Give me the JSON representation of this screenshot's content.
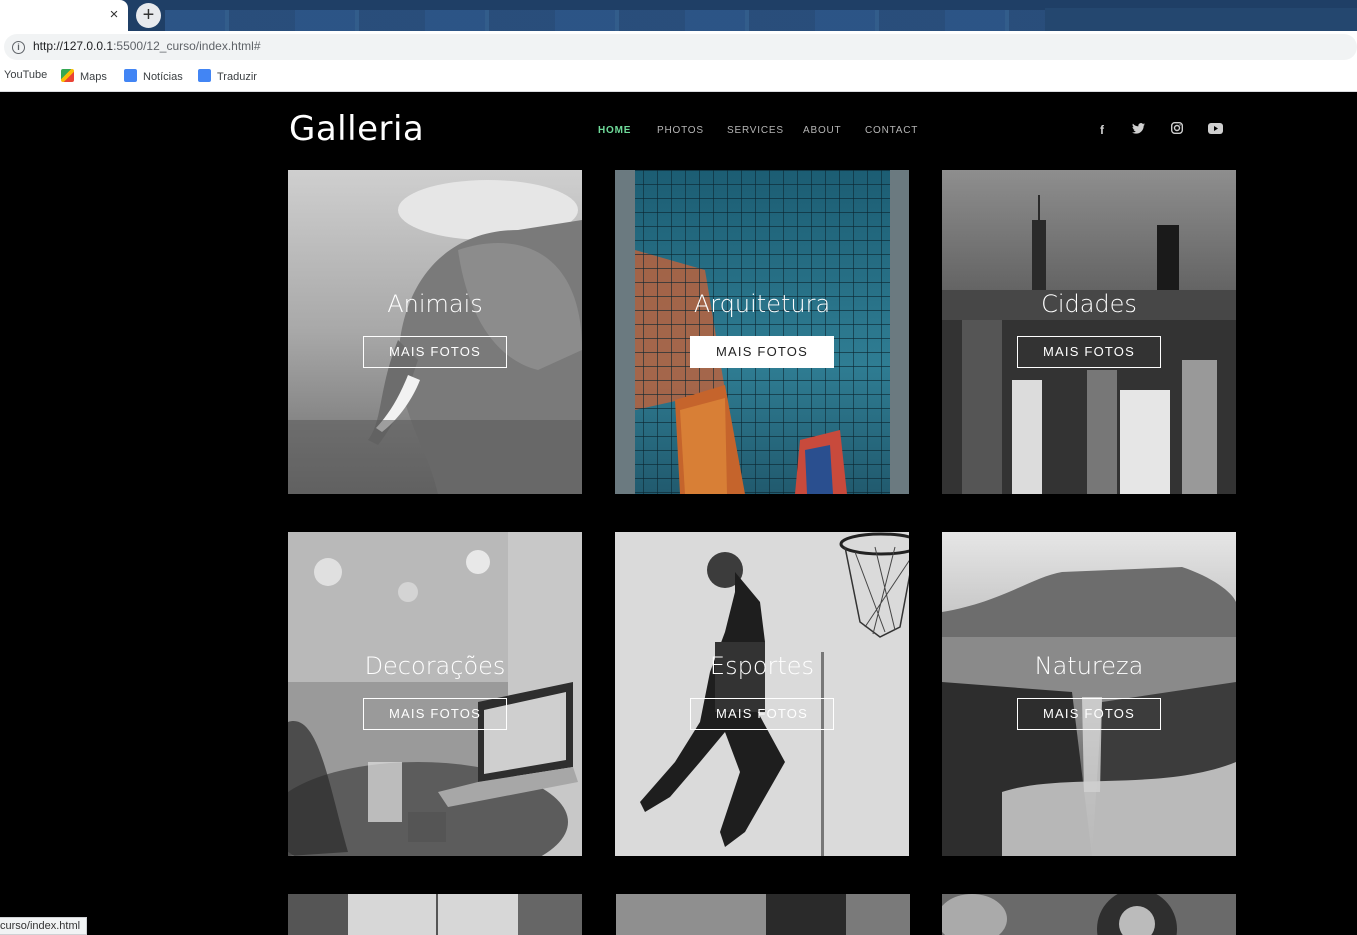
{
  "browser": {
    "tab_close": "×",
    "new_tab": "+",
    "url_host": "http://127.0.0.1",
    "url_rest": ":5500/12_curso/index.html#",
    "bookmarks": [
      {
        "label": "YouTube",
        "icon": "youtube-icon",
        "color": ""
      },
      {
        "label": "Maps",
        "icon": "maps-icon",
        "color": "#34a853"
      },
      {
        "label": "Notícias",
        "icon": "news-icon",
        "color": "#4285f4"
      },
      {
        "label": "Traduzir",
        "icon": "translate-icon",
        "color": "#4285f4"
      }
    ],
    "status_url": "curso/index.html"
  },
  "site": {
    "logo": "Galleria",
    "nav": [
      {
        "label": "HOME",
        "active": true
      },
      {
        "label": "PHOTOS",
        "active": false
      },
      {
        "label": "SERVICES",
        "active": false
      },
      {
        "label": "ABOUT",
        "active": false
      },
      {
        "label": "CONTACT",
        "active": false
      }
    ],
    "social": [
      {
        "icon": "facebook-icon",
        "glyph": "f"
      },
      {
        "icon": "twitter-icon",
        "glyph": "t"
      },
      {
        "icon": "instagram-icon",
        "glyph": "◎"
      },
      {
        "icon": "youtube-icon",
        "glyph": "▶"
      }
    ],
    "accent_color": "#6fdb9a"
  },
  "gallery": [
    {
      "title": "Animais",
      "button": "MAIS FOTOS",
      "image": "elephant-photo",
      "highlighted": false
    },
    {
      "title": "Arquitetura",
      "button": "MAIS FOTOS",
      "image": "building-photo",
      "highlighted": true
    },
    {
      "title": "Cidades",
      "button": "MAIS FOTOS",
      "image": "city-photo",
      "highlighted": false
    },
    {
      "title": "Decorações",
      "button": "MAIS FOTOS",
      "image": "laptop-table-photo",
      "highlighted": false
    },
    {
      "title": "Esportes",
      "button": "MAIS FOTOS",
      "image": "basketball-photo",
      "highlighted": false
    },
    {
      "title": "Natureza",
      "button": "MAIS FOTOS",
      "image": "landscape-photo",
      "highlighted": false
    }
  ]
}
